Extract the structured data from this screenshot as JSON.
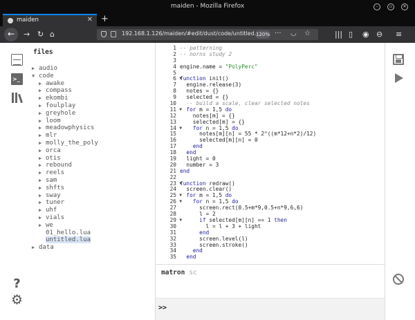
{
  "window": {
    "title": "maiden - Mozilla Firefox"
  },
  "tab": {
    "label": "maiden",
    "close": "✕"
  },
  "newtab": "+",
  "urlbar": {
    "url": "192.168.1.126/maiden/#edit/dust/code/untitled.lua",
    "zoom": "120%"
  },
  "icons": {
    "back": "arrow-left-icon",
    "forward": "arrow-right-icon",
    "reload": "reload-icon",
    "home": "home-icon",
    "menu": "hamburger-icon"
  },
  "files": {
    "title": "files",
    "tree": [
      {
        "label": "audio",
        "indent": 0,
        "type": "folder-closed"
      },
      {
        "label": "code",
        "indent": 0,
        "type": "folder-open"
      },
      {
        "label": "awake",
        "indent": 1,
        "type": "folder-closed"
      },
      {
        "label": "compass",
        "indent": 1,
        "type": "folder-closed"
      },
      {
        "label": "ekombi",
        "indent": 1,
        "type": "folder-closed"
      },
      {
        "label": "foulplay",
        "indent": 1,
        "type": "folder-closed"
      },
      {
        "label": "greyhole",
        "indent": 1,
        "type": "folder-closed"
      },
      {
        "label": "loom",
        "indent": 1,
        "type": "folder-closed"
      },
      {
        "label": "meadowphysics",
        "indent": 1,
        "type": "folder-closed"
      },
      {
        "label": "mlr",
        "indent": 1,
        "type": "folder-closed"
      },
      {
        "label": "molly_the_poly",
        "indent": 1,
        "type": "folder-closed"
      },
      {
        "label": "orca",
        "indent": 1,
        "type": "folder-closed"
      },
      {
        "label": "otis",
        "indent": 1,
        "type": "folder-closed"
      },
      {
        "label": "rebound",
        "indent": 1,
        "type": "folder-closed"
      },
      {
        "label": "reels",
        "indent": 1,
        "type": "folder-closed"
      },
      {
        "label": "sam",
        "indent": 1,
        "type": "folder-closed"
      },
      {
        "label": "shfts",
        "indent": 1,
        "type": "folder-closed"
      },
      {
        "label": "sway",
        "indent": 1,
        "type": "folder-closed"
      },
      {
        "label": "tuner",
        "indent": 1,
        "type": "folder-closed"
      },
      {
        "label": "uhf",
        "indent": 1,
        "type": "folder-closed"
      },
      {
        "label": "vials",
        "indent": 1,
        "type": "folder-closed"
      },
      {
        "label": "we",
        "indent": 1,
        "type": "folder-closed"
      },
      {
        "label": "01_hello.lua",
        "indent": 1,
        "type": "file"
      },
      {
        "label": "untitled.lua",
        "indent": 1,
        "type": "file",
        "selected": true
      },
      {
        "label": "data",
        "indent": 0,
        "type": "folder-closed"
      }
    ]
  },
  "editor": {
    "lines": [
      {
        "n": "1",
        "t": "-- patterning",
        "cls": "c-com"
      },
      {
        "n": "2",
        "t": "-- norns study 2",
        "cls": "c-com"
      },
      {
        "n": "3",
        "t": ""
      },
      {
        "n": "4",
        "t": "engine.name = \"PolyPerc\""
      },
      {
        "n": "5",
        "t": ""
      },
      {
        "n": "6",
        "t": "function init()",
        "fold": true
      },
      {
        "n": "7",
        "t": "  engine.release(3)"
      },
      {
        "n": "8",
        "t": "  notes = {}"
      },
      {
        "n": "9",
        "t": "  selected = {}"
      },
      {
        "n": "10",
        "t": "  -- build a scale, clear selected notes",
        "cls": "c-com"
      },
      {
        "n": "11",
        "t": "  for m = 1,5 do",
        "fold": true
      },
      {
        "n": "12",
        "t": "    notes[m] = {}"
      },
      {
        "n": "13",
        "t": "    selected[m] = {}"
      },
      {
        "n": "14",
        "t": "    for n = 1,5 do",
        "fold": true
      },
      {
        "n": "15",
        "t": "      notes[m][n] = 55 * 2^((m*12+n*2)/12)"
      },
      {
        "n": "16",
        "t": "      selected[m][n] = 0"
      },
      {
        "n": "17",
        "t": "    end"
      },
      {
        "n": "18",
        "t": "  end"
      },
      {
        "n": "19",
        "t": "  light = 0"
      },
      {
        "n": "20",
        "t": "  number = 3"
      },
      {
        "n": "21",
        "t": "end"
      },
      {
        "n": "22",
        "t": ""
      },
      {
        "n": "23",
        "t": "function redraw()",
        "fold": true
      },
      {
        "n": "24",
        "t": "  screen.clear()"
      },
      {
        "n": "25",
        "t": "  for m = 1,5 do",
        "fold": true
      },
      {
        "n": "26",
        "t": "    for n = 1,5 do",
        "fold": true
      },
      {
        "n": "27",
        "t": "      screen.rect(0.5+m*9,0.5+n*9,6,6)"
      },
      {
        "n": "28",
        "t": "      l = 2"
      },
      {
        "n": "29",
        "t": "      if selected[m][n] == 1 then",
        "fold": true
      },
      {
        "n": "30",
        "t": "        l = l + 3 + light"
      },
      {
        "n": "31",
        "t": "      end"
      },
      {
        "n": "32",
        "t": "      screen.level(l)"
      },
      {
        "n": "33",
        "t": "      screen.stroke()"
      },
      {
        "n": "34",
        "t": "    end"
      },
      {
        "n": "35",
        "t": "  end"
      }
    ]
  },
  "repl": {
    "tabs": [
      "matron",
      "sc"
    ],
    "active": 0,
    "prompt": ">>"
  },
  "colors": {
    "chrome_dark": "#0c0c0d",
    "chrome_toolbar": "#323234",
    "tab_accent": "#0a84ff",
    "selection": "#d6e4f5"
  }
}
